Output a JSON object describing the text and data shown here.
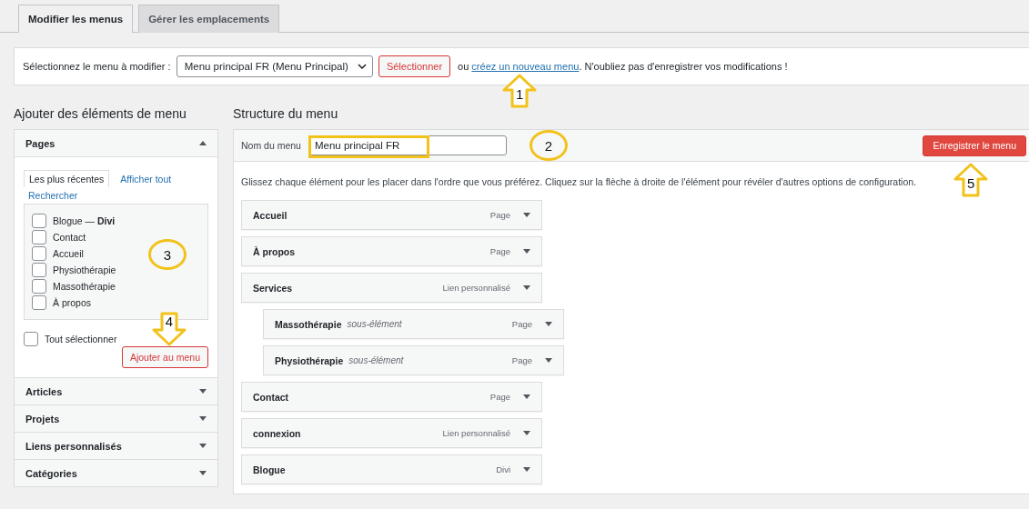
{
  "tabs": [
    {
      "label": "Modifier les menus",
      "selected": true
    },
    {
      "label": "Gérer les emplacements",
      "selected": false
    }
  ],
  "selector_bar": {
    "label": "Sélectionnez le menu à modifier :",
    "dropdown": "Menu principal FR (Menu Principal)",
    "button": "Sélectionner",
    "text_before_link": "ou",
    "link": "créez un nouveau menu",
    "text_after_link": ". N'oubliez pas d'enregistrer vos modifications !",
    "annotation": {
      "kind": "arrow-up",
      "label": "1"
    }
  },
  "add_items": {
    "title": "Ajouter des éléments de menu",
    "sections": [
      {
        "title": "Pages",
        "expanded": true,
        "tabs": [
          {
            "label": "Les plus récentes",
            "selected": true
          },
          {
            "label": "Afficher tout",
            "selected": false
          },
          {
            "label": "Rechercher",
            "selected": false
          }
        ],
        "items": [
          {
            "label": "Blogue — **Divi**",
            "checked": false
          },
          {
            "label": "Contact",
            "checked": false
          },
          {
            "label": "Accueil",
            "checked": false
          },
          {
            "label": "Physiothérapie",
            "checked": false
          },
          {
            "label": "Massothérapie",
            "checked": false
          },
          {
            "label": "À propos",
            "checked": false
          }
        ],
        "select_all": {
          "label": "Tout sélectionner",
          "checked": false
        },
        "button": "Ajouter au menu",
        "annotations": [
          {
            "kind": "circle",
            "label": "3"
          },
          {
            "kind": "arrow-down",
            "label": "4"
          }
        ]
      },
      {
        "title": "Articles",
        "expanded": false
      },
      {
        "title": "Projets",
        "expanded": false
      },
      {
        "title": "Liens personnalisés",
        "expanded": false
      },
      {
        "title": "Catégories",
        "expanded": false
      }
    ]
  },
  "structure": {
    "title": "Structure du menu",
    "name_label": "Nom du menu",
    "name_value": "Menu principal FR",
    "name_highlighted": true,
    "name_annotation": {
      "kind": "circle",
      "label": "2"
    },
    "save_button": "Enregistrer le menu",
    "save_annotation": {
      "kind": "arrow-up",
      "label": "5"
    },
    "instructions": "Glissez chaque élément pour les placer dans l'ordre que vous préférez. Cliquez sur la flèche à droite de l'élément pour révéler d'autres options de configuration.",
    "items": [
      {
        "title": "Accueil",
        "type": "Page"
      },
      {
        "title": "À propos",
        "type": "Page"
      },
      {
        "title": "Services",
        "type": "Lien personnalisé",
        "children": [
          {
            "title": "Massothérapie",
            "sublabel": "sous-élément",
            "type": "Page"
          },
          {
            "title": "Physiothérapie",
            "sublabel": "sous-élément",
            "type": "Page"
          }
        ]
      },
      {
        "title": "Contact",
        "type": "Page"
      },
      {
        "title": "connexion",
        "type": "Lien personnalisé"
      },
      {
        "title": "Blogue",
        "type": "Divi"
      }
    ]
  }
}
